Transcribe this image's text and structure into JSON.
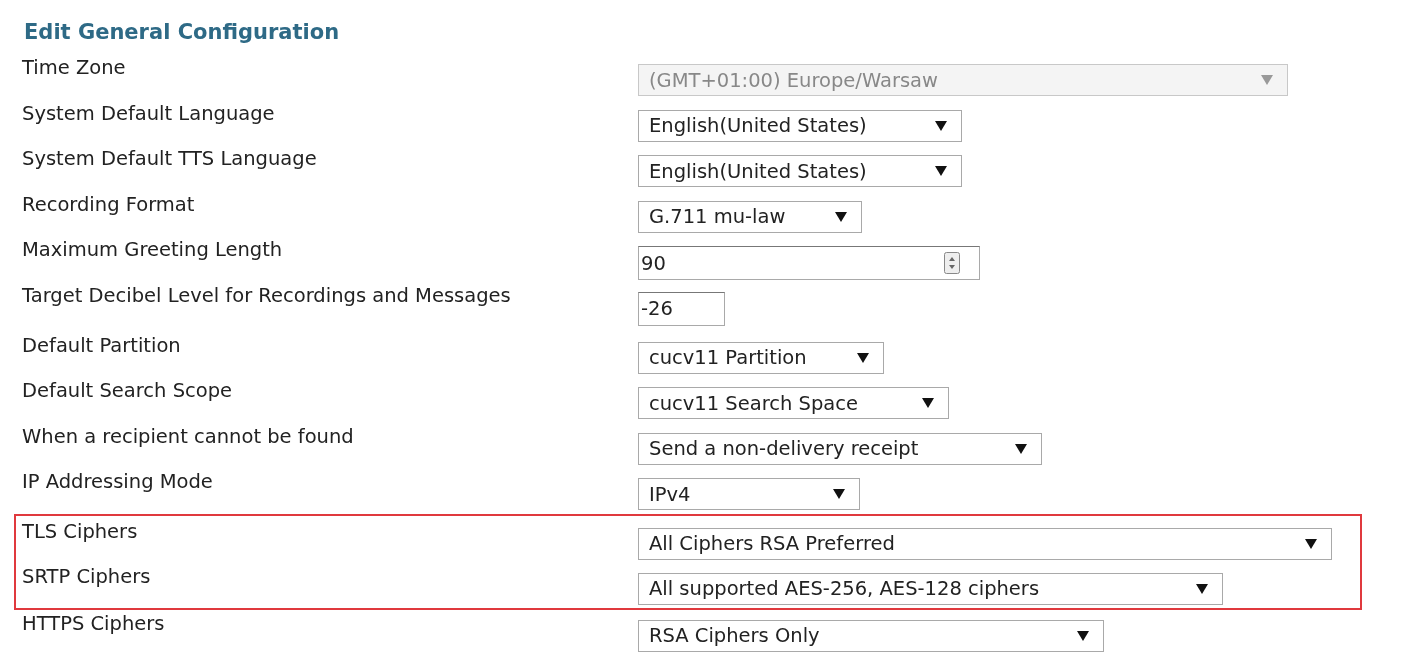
{
  "title": "Edit General Configuration",
  "rows": [
    {
      "label": "Time Zone",
      "kind": "select",
      "value": "(GMT+01:00) Europe/Warsaw",
      "disabled": true,
      "highlighted": false
    },
    {
      "label": "System Default Language",
      "kind": "select",
      "value": "English(United States)",
      "disabled": false,
      "highlighted": false
    },
    {
      "label": "System Default TTS Language",
      "kind": "select",
      "value": "English(United States)",
      "disabled": false,
      "highlighted": false
    },
    {
      "label": "Recording Format",
      "kind": "select",
      "value": "G.711 mu-law",
      "disabled": false,
      "highlighted": false
    },
    {
      "label": "Maximum Greeting Length",
      "kind": "number",
      "value": "90",
      "highlighted": false
    },
    {
      "label": "Target Decibel Level for Recordings and Messages",
      "kind": "text",
      "value": "-26",
      "highlighted": false
    },
    {
      "label": "Default Partition",
      "kind": "select",
      "value": "cucv11 Partition",
      "disabled": false,
      "highlighted": false
    },
    {
      "label": "Default Search Scope",
      "kind": "select",
      "value": "cucv11 Search Space",
      "disabled": false,
      "highlighted": false
    },
    {
      "label": "When a recipient cannot be found",
      "kind": "select",
      "value": "Send a non-delivery receipt",
      "disabled": false,
      "highlighted": false
    },
    {
      "label": "IP Addressing Mode",
      "kind": "select",
      "value": "IPv4",
      "disabled": false,
      "highlighted": false
    },
    {
      "label": "TLS Ciphers",
      "kind": "select",
      "value": "All Ciphers RSA Preferred",
      "disabled": false,
      "highlighted": true
    },
    {
      "label": "SRTP Ciphers",
      "kind": "select",
      "value": "All supported AES-256, AES-128 ciphers",
      "disabled": false,
      "highlighted": true
    },
    {
      "label": "HTTPS Ciphers",
      "kind": "select",
      "value": "RSA Ciphers Only",
      "disabled": false,
      "highlighted": false
    }
  ]
}
